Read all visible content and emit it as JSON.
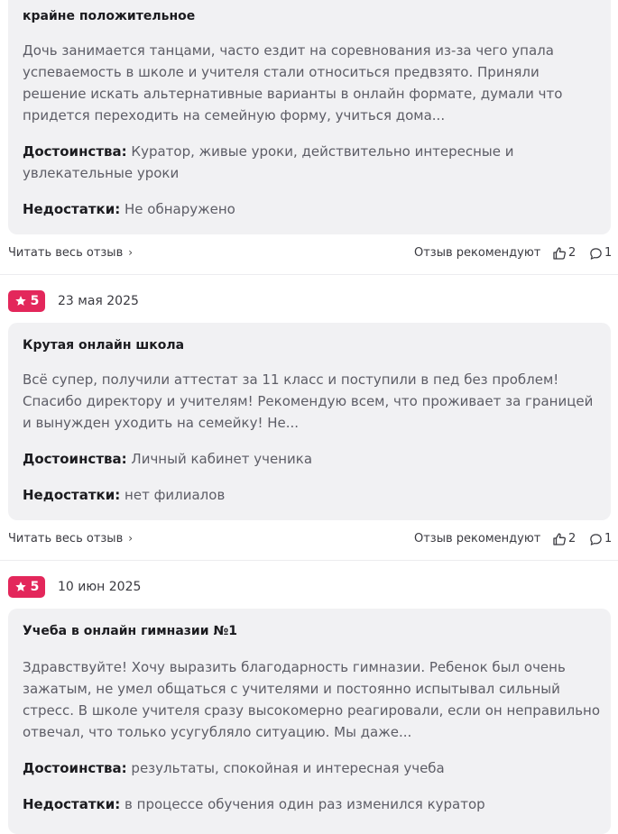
{
  "colors": {
    "accent": "#e3275b",
    "card_bg": "#f1f1f3"
  },
  "reviews": [
    {
      "title": "крайне положительное",
      "text": "Дочь занимается танцами, часто ездит на соревнования из-за чего упала\nуспеваемость в школе и учителя стали относиться предвзято. Приняли\nрешение искать альтернативные варианты в онлайн формате, думали что\nпридется переходить на семейную форму, учиться дома...",
      "pros_label": "Достоинства:",
      "pros": "Куратор, живые уроки, действительно интересные и увлекательные уроки",
      "cons_label": "Недостатки:",
      "cons": "Не обнаружено",
      "read_more": "Читать весь отзыв",
      "recommend_label": "Отзыв рекомендуют",
      "likes": "2",
      "comments": "1"
    },
    {
      "rating": "5",
      "date": "23 мая 2025",
      "title": "Крутая онлайн школа",
      "text": "Всё супер, получили аттестат за 11 класс и поступили в пед без проблем!\nСпасибо директору и учителям! Рекомендую всем, что проживает за границей\nи вынужден уходить на семейку! Не...",
      "pros_label": "Достоинства:",
      "pros": "Личный кабинет ученика",
      "cons_label": "Недостатки:",
      "cons": "нет филиалов",
      "read_more": "Читать весь отзыв",
      "recommend_label": "Отзыв рекомендуют",
      "likes": "2",
      "comments": "1"
    },
    {
      "rating": "5",
      "date": "10 июн 2025",
      "title": "Учеба в онлайн гимназии №1",
      "text": "Здравствуйте! Хочу выразить благодарность гимназии. Ребенок был очень\nзажатым, не умел общаться с учителями и постоянно испытывал сильный\nстресс. В школе учителя сразу высокомерно реагировали, если он неправильно\nотвечал, что только усугубляло ситуацию. Мы даже...",
      "pros_label": "Достоинства:",
      "pros": "результаты, спокойная и интересная учеба",
      "cons_label": "Недостатки:",
      "cons": "в процессе обучения один раз изменился куратор"
    }
  ],
  "icons": {
    "chevron": "chevron-right-icon",
    "like": "thumbs-up-icon",
    "comment": "comment-icon",
    "star": "star-icon"
  }
}
